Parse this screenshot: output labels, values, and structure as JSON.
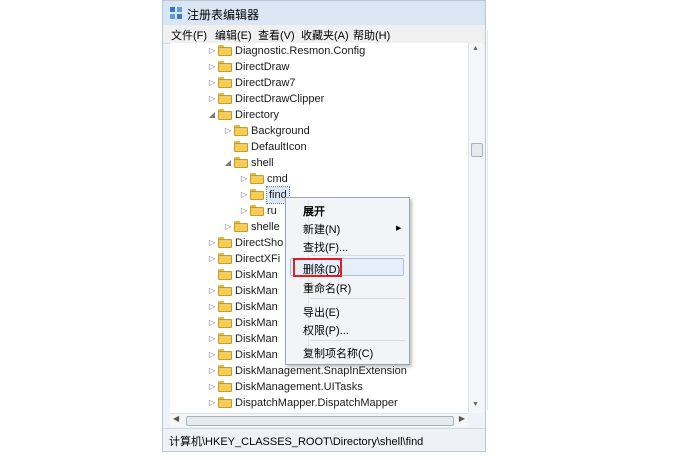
{
  "window": {
    "title": "注册表编辑器"
  },
  "menu": [
    "文件(F)",
    "编辑(E)",
    "查看(V)",
    "收藏夹(A)",
    "帮助(H)"
  ],
  "tree": [
    {
      "label": "Diagnostic.Resmon.Config",
      "indent": 0,
      "expand": "collapsed"
    },
    {
      "label": "DirectDraw",
      "indent": 0,
      "expand": "collapsed"
    },
    {
      "label": "DirectDraw7",
      "indent": 0,
      "expand": "collapsed"
    },
    {
      "label": "DirectDrawClipper",
      "indent": 0,
      "expand": "collapsed"
    },
    {
      "label": "Directory",
      "indent": 0,
      "expand": "expanded"
    },
    {
      "label": "Background",
      "indent": 1,
      "expand": "collapsed"
    },
    {
      "label": "DefaultIcon",
      "indent": 1,
      "expand": "none"
    },
    {
      "label": "shell",
      "indent": 1,
      "expand": "expanded"
    },
    {
      "label": "cmd",
      "indent": 2,
      "expand": "collapsed"
    },
    {
      "label": "find",
      "indent": 2,
      "expand": "collapsed",
      "selected": true
    },
    {
      "label": "ru",
      "indent": 2,
      "expand": "collapsed"
    },
    {
      "label": "shelle",
      "indent": 1,
      "expand": "collapsed"
    },
    {
      "label": "DirectSho",
      "indent": 0,
      "expand": "collapsed"
    },
    {
      "label": "DirectXFi",
      "indent": 0,
      "expand": "collapsed"
    },
    {
      "label": "DiskMan",
      "indent": 0,
      "expand": "none"
    },
    {
      "label": "DiskMan",
      "indent": 0,
      "expand": "collapsed"
    },
    {
      "label": "DiskMan",
      "indent": 0,
      "expand": "collapsed"
    },
    {
      "label": "DiskMan",
      "indent": 0,
      "expand": "collapsed"
    },
    {
      "label": "DiskMan",
      "indent": 0,
      "expand": "collapsed"
    },
    {
      "label": "DiskMan",
      "indent": 0,
      "expand": "collapsed"
    },
    {
      "label": "DiskManagement.SnapInExtension",
      "indent": 0,
      "expand": "collapsed"
    },
    {
      "label": "DiskManagement.UITasks",
      "indent": 0,
      "expand": "collapsed"
    },
    {
      "label": "DispatchMapper.DispatchMapper",
      "indent": 0,
      "expand": "collapsed"
    }
  ],
  "context_menu": {
    "expand": "展开",
    "new": "新建(N)",
    "find": "查找(F)...",
    "delete": "删除(D)",
    "rename": "重命名(R)",
    "export": "导出(E)",
    "permissions": "权限(P)...",
    "copy_key_name": "复制项名称(C)"
  },
  "status": {
    "path": "计算机\\HKEY_CLASSES_ROOT\\Directory\\shell\\find"
  },
  "colors": {
    "highlight_box": "#e02020",
    "folder": "#f3cd58"
  }
}
